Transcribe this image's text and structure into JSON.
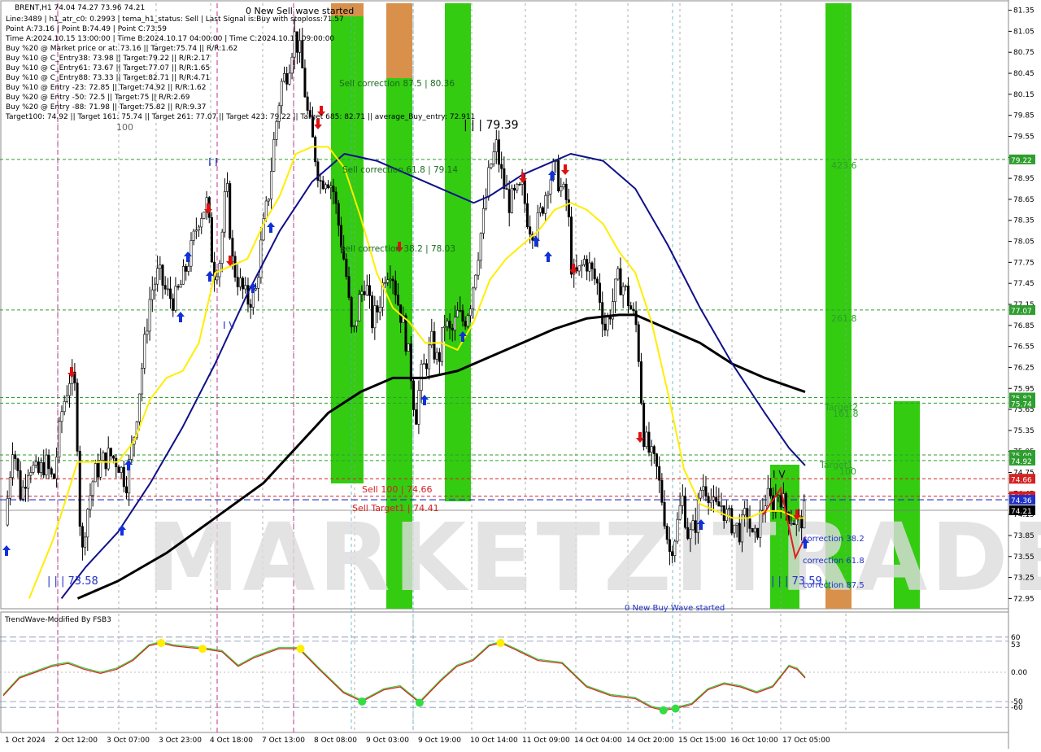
{
  "header": {
    "symbol_line": "BRENT,H1  74.04 74.27 73.96 74.21",
    "info_lines": [
      "Line:3489 | h1_atr_c0: 0.2993 | tema_h1_status: Sell | Last Signal is:Buy with stoploss:71.57",
      "Point A:73.16 | Point B:74.49 | Point C:73.59",
      "Time A:2024.10.15 13:00:00 | Time B:2024.10.17 04:00:00 | Time C:2024.10.17 09:00:00",
      "Buy %20 @ Market price or at: 73.16 || Target:75.74 || R/R:1.62",
      "Buy %10 @ C_Entry38: 73.98 || Target:79.22 || R/R:2.17",
      "Buy %10 @ C_Entry61: 73.67 || Target:77.07 || R/R:1.65",
      "Buy %10 @ C_Entry88: 73.33 || Target:82.71 || R/R:4.71",
      "Buy %10 @ Entry -23: 72.85 || Target:74.92 || R/R:1.62",
      "Buy %20 @ Entry -50: 72.5 || Target:75 || R/R:2.69",
      "Buy %20 @ Entry -88: 71.98 || Target:75.82 || R/R:9.37",
      "Target100: 74.92 || Target 161: 75.74 || Target 261: 77.07 || Target 423: 79.22 || Target 685: 82.71 || average_Buy_entry: 72.911"
    ]
  },
  "watermark": "MARKETZITRADE",
  "labels": {
    "new_sell_wave": "0 New Sell wave started",
    "new_buy_wave": "0 New Buy Wave started",
    "sell_corr_875": "Sell correction 87.5 | 80.36",
    "sell_corr_618": "Sell correction 61.8 | 79.14",
    "sell_corr_382": "Sell correction 38.2 | 78.03",
    "sell_100": "Sell 100 | 74.66",
    "sell_target1": "Sell Target1 | 74.41",
    "peak_label": "| | | 79.39",
    "low_label": "| | | 73.58",
    "c_label": "| | | 73.59",
    "lbl_100": "100",
    "lbl_423": "423.6",
    "lbl_261": "261.8",
    "lbl_161": "161.8",
    "lbl_100b": "100",
    "target2": "Target2",
    "target1": "Target1",
    "corr_382": "correction 38.2",
    "corr_618": "correction 61.8",
    "corr_875": "correction 87.5",
    "iv": "I V",
    "ii": "I I",
    "iv_left": "I V"
  },
  "price_axis": {
    "ticks": [
      "81.35",
      "81.05",
      "80.75",
      "80.45",
      "80.15",
      "79.85",
      "79.55",
      "79.25",
      "78.95",
      "78.65",
      "78.35",
      "78.05",
      "77.75",
      "77.45",
      "77.15",
      "76.85",
      "76.55",
      "76.25",
      "75.95",
      "75.65",
      "75.35",
      "75.05",
      "74.75",
      "74.45",
      "74.15",
      "73.85",
      "73.55",
      "73.25",
      "72.95"
    ],
    "markers": [
      {
        "label": "79.22",
        "price": 79.22,
        "color": "#2e9e2e"
      },
      {
        "label": "77.07",
        "price": 77.07,
        "color": "#2e9e2e"
      },
      {
        "label": "75.82",
        "price": 75.82,
        "color": "#2e9e2e"
      },
      {
        "label": "75.74",
        "price": 75.74,
        "color": "#2e9e2e"
      },
      {
        "label": "75.00",
        "price": 75.0,
        "color": "#2e9e2e"
      },
      {
        "label": "74.92",
        "price": 74.92,
        "color": "#2e9e2e"
      },
      {
        "label": "74.66",
        "price": 74.66,
        "color": "#d42020"
      },
      {
        "label": "74.41",
        "price": 74.41,
        "color": "#d42020"
      },
      {
        "label": "74.36",
        "price": 74.36,
        "color": "#2030c8"
      },
      {
        "label": "74.21",
        "price": 74.21,
        "color": "#000000"
      }
    ]
  },
  "time_axis": [
    "1 Oct 2024",
    "2 Oct 12:00",
    "3 Oct 07:00",
    "3 Oct 23:00",
    "4 Oct 18:00",
    "7 Oct 13:00",
    "8 Oct 08:00",
    "9 Oct 03:00",
    "9 Oct 19:00",
    "10 Oct 14:00",
    "11 Oct 09:00",
    "14 Oct 04:00",
    "14 Oct 20:00",
    "15 Oct 15:00",
    "16 Oct 10:00",
    "17 Oct 05:00"
  ],
  "indicator": {
    "title": "TrendWave-Modified By FSB3",
    "ticks": [
      "60",
      "53",
      "0.00",
      "-50",
      "-60"
    ]
  },
  "colors": {
    "bull_band": "#33cc11",
    "sell_band": "#d9904a",
    "ma_yellow": "#ffee00",
    "ma_blue": "#10108a",
    "ma_black": "#000000",
    "target_green": "#2e9e2e",
    "sell_red": "#d42020"
  },
  "chart_data": {
    "type": "candlestick",
    "symbol": "BRENT",
    "timeframe": "H1",
    "ylim": [
      72.85,
      81.45
    ],
    "x_range": [
      0,
      1000
    ],
    "close_path": [
      [
        0,
        74.0
      ],
      [
        10,
        75.2
      ],
      [
        20,
        74.4
      ],
      [
        30,
        74.9
      ],
      [
        40,
        74.7
      ],
      [
        50,
        74.9
      ],
      [
        60,
        74.6
      ],
      [
        70,
        75.6
      ],
      [
        80,
        76.1
      ],
      [
        88,
        75.9
      ],
      [
        92,
        74.2
      ],
      [
        96,
        73.6
      ],
      [
        100,
        74.1
      ],
      [
        110,
        74.7
      ],
      [
        120,
        74.9
      ],
      [
        130,
        75.0
      ],
      [
        140,
        74.9
      ],
      [
        150,
        74.6
      ],
      [
        160,
        75.3
      ],
      [
        170,
        76.3
      ],
      [
        180,
        77.3
      ],
      [
        190,
        77.6
      ],
      [
        200,
        77.3
      ],
      [
        210,
        77.2
      ],
      [
        220,
        77.5
      ],
      [
        230,
        77.9
      ],
      [
        240,
        78.4
      ],
      [
        250,
        78.6
      ],
      [
        258,
        77.6
      ],
      [
        266,
        77.8
      ],
      [
        274,
        78.9
      ],
      [
        282,
        77.7
      ],
      [
        292,
        77.4
      ],
      [
        300,
        77.2
      ],
      [
        310,
        77.3
      ],
      [
        318,
        78.1
      ],
      [
        326,
        78.7
      ],
      [
        334,
        79.6
      ],
      [
        342,
        80.3
      ],
      [
        350,
        80.5
      ],
      [
        358,
        81.0
      ],
      [
        366,
        80.7
      ],
      [
        374,
        79.9
      ],
      [
        382,
        79.4
      ],
      [
        390,
        78.9
      ],
      [
        398,
        79.0
      ],
      [
        406,
        78.8
      ],
      [
        414,
        78.2
      ],
      [
        422,
        77.6
      ],
      [
        430,
        76.6
      ],
      [
        438,
        77.2
      ],
      [
        446,
        77.5
      ],
      [
        454,
        76.9
      ],
      [
        462,
        77.1
      ],
      [
        470,
        77.6
      ],
      [
        478,
        77.7
      ],
      [
        486,
        77.2
      ],
      [
        494,
        76.8
      ],
      [
        502,
        76.2
      ],
      [
        508,
        75.5
      ],
      [
        514,
        76.1
      ],
      [
        520,
        76.3
      ],
      [
        528,
        76.6
      ],
      [
        536,
        76.3
      ],
      [
        544,
        76.9
      ],
      [
        552,
        76.7
      ],
      [
        560,
        77.0
      ],
      [
        568,
        76.9
      ],
      [
        576,
        77.2
      ],
      [
        584,
        77.8
      ],
      [
        592,
        78.4
      ],
      [
        600,
        79.1
      ],
      [
        608,
        79.4
      ],
      [
        616,
        78.9
      ],
      [
        624,
        78.6
      ],
      [
        632,
        78.7
      ],
      [
        640,
        78.8
      ],
      [
        648,
        78.3
      ],
      [
        656,
        78.2
      ],
      [
        664,
        78.5
      ],
      [
        672,
        78.9
      ],
      [
        680,
        79.1
      ],
      [
        688,
        78.8
      ],
      [
        696,
        78.6
      ],
      [
        702,
        77.5
      ],
      [
        710,
        77.6
      ],
      [
        718,
        77.8
      ],
      [
        726,
        77.6
      ],
      [
        734,
        77.4
      ],
      [
        742,
        76.8
      ],
      [
        750,
        77.1
      ],
      [
        758,
        77.5
      ],
      [
        766,
        77.4
      ],
      [
        774,
        77.1
      ],
      [
        782,
        76.8
      ],
      [
        790,
        75.3
      ],
      [
        798,
        75.0
      ],
      [
        806,
        74.8
      ],
      [
        814,
        74.3
      ],
      [
        822,
        73.6
      ],
      [
        830,
        73.9
      ],
      [
        838,
        74.4
      ],
      [
        846,
        73.8
      ],
      [
        854,
        74.0
      ],
      [
        862,
        74.6
      ],
      [
        870,
        74.5
      ],
      [
        878,
        74.2
      ],
      [
        886,
        74.3
      ],
      [
        894,
        74.1
      ],
      [
        902,
        74.0
      ],
      [
        910,
        73.9
      ],
      [
        918,
        74.2
      ],
      [
        926,
        73.7
      ],
      [
        934,
        74.1
      ],
      [
        942,
        74.4
      ],
      [
        950,
        74.3
      ],
      [
        958,
        74.5
      ],
      [
        966,
        74.2
      ],
      [
        974,
        74.1
      ],
      [
        982,
        74.0
      ],
      [
        990,
        74.21
      ]
    ],
    "ma_yellow": [
      [
        30,
        72.95
      ],
      [
        60,
        73.8
      ],
      [
        90,
        74.9
      ],
      [
        140,
        74.9
      ],
      [
        160,
        75.2
      ],
      [
        180,
        75.8
      ],
      [
        200,
        76.1
      ],
      [
        220,
        76.2
      ],
      [
        240,
        76.6
      ],
      [
        260,
        77.6
      ],
      [
        300,
        77.8
      ],
      [
        320,
        78.3
      ],
      [
        340,
        78.7
      ],
      [
        360,
        79.3
      ],
      [
        380,
        79.4
      ],
      [
        400,
        79.4
      ],
      [
        420,
        79.1
      ],
      [
        440,
        78.4
      ],
      [
        460,
        77.6
      ],
      [
        480,
        77.1
      ],
      [
        500,
        76.9
      ],
      [
        520,
        76.6
      ],
      [
        540,
        76.6
      ],
      [
        560,
        76.5
      ],
      [
        580,
        76.9
      ],
      [
        600,
        77.5
      ],
      [
        620,
        77.8
      ],
      [
        640,
        78.0
      ],
      [
        660,
        78.2
      ],
      [
        680,
        78.5
      ],
      [
        700,
        78.6
      ],
      [
        720,
        78.5
      ],
      [
        740,
        78.3
      ],
      [
        760,
        77.9
      ],
      [
        780,
        77.6
      ],
      [
        800,
        76.9
      ],
      [
        820,
        75.9
      ],
      [
        840,
        74.8
      ],
      [
        860,
        74.3
      ],
      [
        880,
        74.2
      ],
      [
        900,
        74.1
      ],
      [
        920,
        74.1
      ],
      [
        940,
        74.2
      ],
      [
        960,
        74.2
      ],
      [
        980,
        74.1
      ],
      [
        990,
        74.1
      ]
    ],
    "ma_blue": [
      [
        70,
        72.95
      ],
      [
        100,
        73.4
      ],
      [
        140,
        73.9
      ],
      [
        180,
        74.6
      ],
      [
        220,
        75.4
      ],
      [
        260,
        76.3
      ],
      [
        300,
        77.3
      ],
      [
        340,
        78.2
      ],
      [
        380,
        78.9
      ],
      [
        420,
        79.3
      ],
      [
        460,
        79.2
      ],
      [
        500,
        79.0
      ],
      [
        540,
        78.8
      ],
      [
        580,
        78.6
      ],
      [
        600,
        78.7
      ],
      [
        640,
        79.0
      ],
      [
        680,
        79.2
      ],
      [
        700,
        79.3
      ],
      [
        740,
        79.2
      ],
      [
        780,
        78.8
      ],
      [
        820,
        78.0
      ],
      [
        860,
        77.1
      ],
      [
        900,
        76.3
      ],
      [
        940,
        75.6
      ],
      [
        970,
        75.1
      ],
      [
        990,
        74.85
      ]
    ],
    "ma_black": [
      [
        90,
        72.95
      ],
      [
        140,
        73.2
      ],
      [
        200,
        73.6
      ],
      [
        260,
        74.1
      ],
      [
        320,
        74.6
      ],
      [
        360,
        75.1
      ],
      [
        400,
        75.6
      ],
      [
        440,
        75.9
      ],
      [
        480,
        76.1
      ],
      [
        520,
        76.1
      ],
      [
        560,
        76.2
      ],
      [
        600,
        76.4
      ],
      [
        640,
        76.6
      ],
      [
        680,
        76.8
      ],
      [
        720,
        76.95
      ],
      [
        760,
        77.0
      ],
      [
        780,
        77.0
      ],
      [
        820,
        76.8
      ],
      [
        860,
        76.6
      ],
      [
        900,
        76.3
      ],
      [
        940,
        76.1
      ],
      [
        990,
        75.9
      ]
    ],
    "indicator_ylim": [
      -100,
      100
    ],
    "indicator_red": [
      [
        0,
        -40
      ],
      [
        20,
        -10
      ],
      [
        40,
        0
      ],
      [
        60,
        10
      ],
      [
        80,
        15
      ],
      [
        100,
        5
      ],
      [
        120,
        -2
      ],
      [
        140,
        5
      ],
      [
        160,
        20
      ],
      [
        180,
        45
      ],
      [
        195,
        50
      ],
      [
        210,
        45
      ],
      [
        230,
        42
      ],
      [
        246,
        40
      ],
      [
        270,
        35
      ],
      [
        290,
        10
      ],
      [
        310,
        25
      ],
      [
        340,
        40
      ],
      [
        365,
        40
      ],
      [
        390,
        5
      ],
      [
        420,
        -35
      ],
      [
        443,
        -50
      ],
      [
        470,
        -30
      ],
      [
        490,
        -25
      ],
      [
        514,
        -52
      ],
      [
        540,
        -15
      ],
      [
        560,
        10
      ],
      [
        580,
        20
      ],
      [
        600,
        45
      ],
      [
        614,
        50
      ],
      [
        630,
        40
      ],
      [
        660,
        20
      ],
      [
        690,
        15
      ],
      [
        720,
        -25
      ],
      [
        750,
        -40
      ],
      [
        780,
        -45
      ],
      [
        800,
        -60
      ],
      [
        815,
        -65
      ],
      [
        830,
        -62
      ],
      [
        850,
        -55
      ],
      [
        870,
        -30
      ],
      [
        890,
        -20
      ],
      [
        910,
        -25
      ],
      [
        930,
        -35
      ],
      [
        950,
        -25
      ],
      [
        970,
        10
      ],
      [
        980,
        5
      ],
      [
        990,
        -10
      ]
    ],
    "indicator_green": [
      [
        0,
        -38
      ],
      [
        20,
        -8
      ],
      [
        40,
        2
      ],
      [
        60,
        12
      ],
      [
        80,
        17
      ],
      [
        100,
        7
      ],
      [
        120,
        0
      ],
      [
        140,
        7
      ],
      [
        160,
        22
      ],
      [
        180,
        47
      ],
      [
        195,
        52
      ],
      [
        210,
        47
      ],
      [
        230,
        44
      ],
      [
        246,
        42
      ],
      [
        270,
        37
      ],
      [
        290,
        12
      ],
      [
        310,
        27
      ],
      [
        340,
        42
      ],
      [
        365,
        42
      ],
      [
        390,
        7
      ],
      [
        420,
        -33
      ],
      [
        443,
        -48
      ],
      [
        470,
        -28
      ],
      [
        490,
        -23
      ],
      [
        514,
        -50
      ],
      [
        540,
        -13
      ],
      [
        560,
        12
      ],
      [
        580,
        22
      ],
      [
        600,
        47
      ],
      [
        614,
        52
      ],
      [
        630,
        42
      ],
      [
        660,
        22
      ],
      [
        690,
        17
      ],
      [
        720,
        -23
      ],
      [
        750,
        -38
      ],
      [
        780,
        -43
      ],
      [
        800,
        -58
      ],
      [
        815,
        -63
      ],
      [
        830,
        -60
      ],
      [
        850,
        -53
      ],
      [
        870,
        -28
      ],
      [
        890,
        -18
      ],
      [
        910,
        -23
      ],
      [
        930,
        -33
      ],
      [
        950,
        -23
      ],
      [
        970,
        12
      ],
      [
        980,
        7
      ],
      [
        990,
        -8
      ]
    ],
    "target_levels": [
      79.22,
      77.07,
      75.82,
      75.74,
      75.0,
      74.92
    ],
    "sell_levels": [
      74.66,
      74.41
    ],
    "current_price": 74.21
  }
}
